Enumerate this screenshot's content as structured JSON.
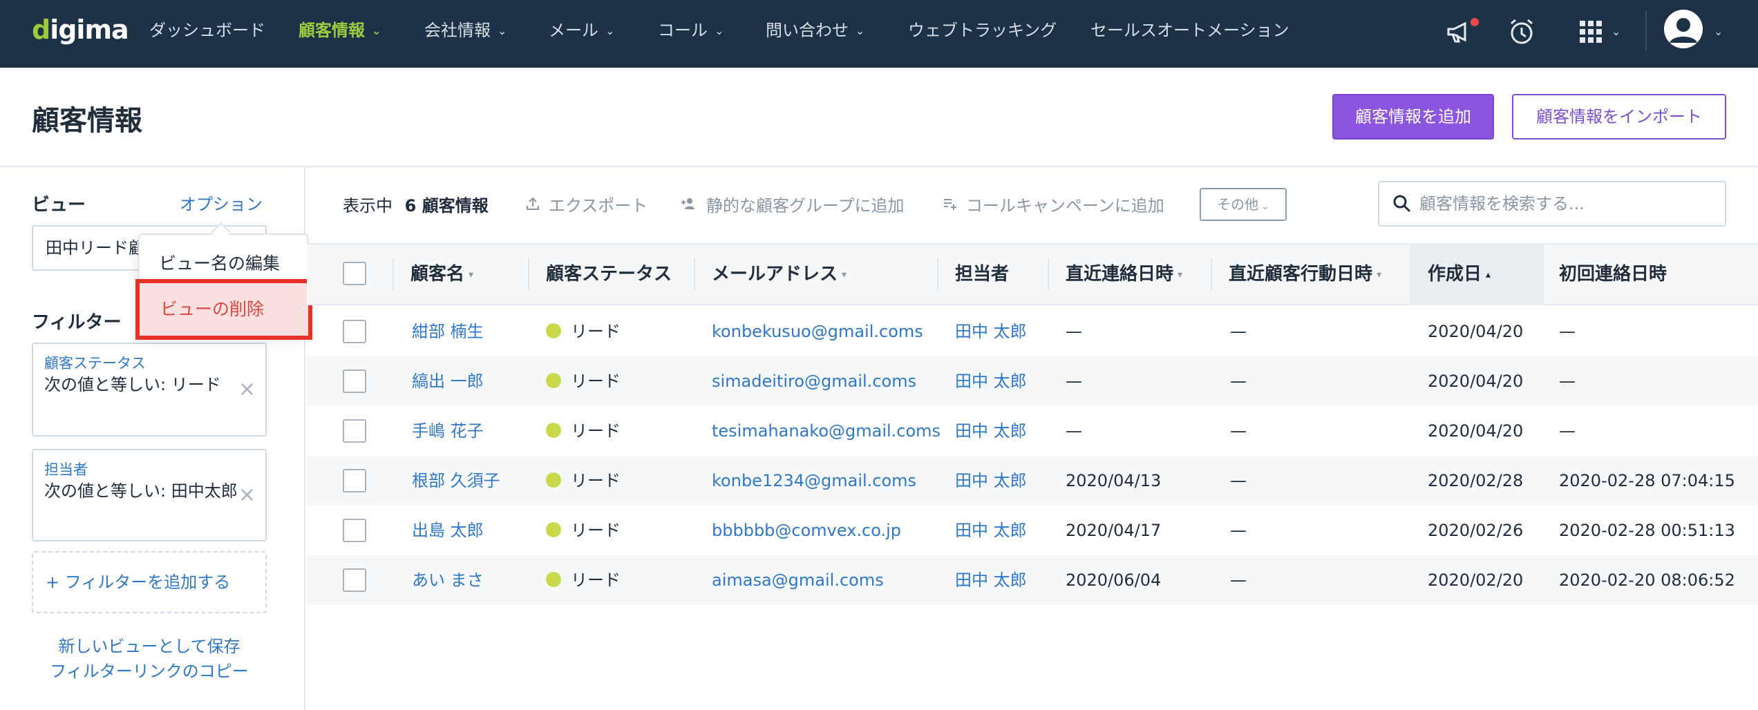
{
  "nav": {
    "logo": "digima",
    "items": [
      {
        "label": "ダッシュボード"
      },
      {
        "label": "顧客情報"
      },
      {
        "label": "会社情報"
      },
      {
        "label": "メール"
      },
      {
        "label": "コール"
      },
      {
        "label": "問い合わせ"
      },
      {
        "label": "ウェブトラッキング"
      },
      {
        "label": "セールスオートメーション"
      }
    ],
    "active_index": 1,
    "icons": [
      "megaphone-icon",
      "alarm-clock-icon",
      "apps-grid-icon",
      "avatar"
    ]
  },
  "header": {
    "title": "顧客情報",
    "add_button": "顧客情報を追加",
    "import_button": "顧客情報をインポート"
  },
  "sidebar": {
    "view_label": "ビュー",
    "options_label": "オプション",
    "selected_view": "田中リード顧客",
    "filter_label": "フィルター",
    "filters": [
      {
        "name": "顧客ステータス",
        "value": "次の値と等しい: リード"
      },
      {
        "name": "担当者",
        "value": "次の値と等しい: 田中太郎"
      }
    ],
    "add_filter": "+  フィルターを追加する",
    "save_as_view": "新しいビューとして保存",
    "copy_filter_link": "フィルターリンクのコピー"
  },
  "options_menu": {
    "edit_view_name": "ビュー名の編集",
    "delete_view": "ビューの削除"
  },
  "toolbar": {
    "showing_prefix": "表示中",
    "showing_count": "6 顧客情報",
    "export": "エクスポート",
    "add_to_static_group": "静的な顧客グループに追加",
    "add_to_call_campaign": "コールキャンペーンに追加",
    "more": "その他",
    "search_placeholder": "顧客情報を検索する..."
  },
  "table": {
    "columns": [
      "顧客名",
      "顧客ステータス",
      "メールアドレス",
      "担当者",
      "直近連絡日時",
      "直近顧客行動日時",
      "作成日",
      "初回連絡日時"
    ],
    "sorted_column": "作成日",
    "rows": [
      {
        "name": "紺部 楠生",
        "status": "リード",
        "email": "konbekusuo@gmail.coms",
        "owner": "田中 太郎",
        "last_contact": "—",
        "last_activity": "—",
        "created": "2020/04/20",
        "first_contact": "—"
      },
      {
        "name": "縞出 一郎",
        "status": "リード",
        "email": "simadeitiro@gmail.coms",
        "owner": "田中 太郎",
        "last_contact": "—",
        "last_activity": "—",
        "created": "2020/04/20",
        "first_contact": "—"
      },
      {
        "name": "手嶋 花子",
        "status": "リード",
        "email": "tesimahanako@gmail.coms",
        "owner": "田中 太郎",
        "last_contact": "—",
        "last_activity": "—",
        "created": "2020/04/20",
        "first_contact": "—"
      },
      {
        "name": "根部 久須子",
        "status": "リード",
        "email": "konbe1234@gmail.coms",
        "owner": "田中 太郎",
        "last_contact": "2020/04/13",
        "last_activity": "—",
        "created": "2020/02/28",
        "first_contact": "2020-02-28 07:04:15"
      },
      {
        "name": "出島 太郎",
        "status": "リード",
        "email": "bbbbbb@comvex.co.jp",
        "owner": "田中 太郎",
        "last_contact": "2020/04/17",
        "last_activity": "—",
        "created": "2020/02/26",
        "first_contact": "2020-02-28 00:51:13"
      },
      {
        "name": "あい まさ",
        "status": "リード",
        "email": "aimasa@gmail.coms",
        "owner": "田中 太郎",
        "last_contact": "2020/06/04",
        "last_activity": "—",
        "created": "2020/02/20",
        "first_contact": "2020-02-20 08:06:52"
      }
    ]
  },
  "colors": {
    "nav_bg": "#1d3247",
    "accent_green": "#9ccc3d",
    "primary_purple": "#8b55e0",
    "link_blue": "#2e78c9",
    "highlight_red": "#e8312a",
    "lead_dot": "#c9d94a"
  }
}
